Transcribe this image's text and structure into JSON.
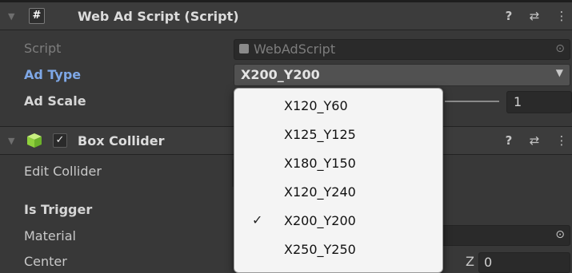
{
  "colors": {
    "panel_bg": "#383838",
    "header_bg": "#3c3c3c",
    "highlight_label": "#7ea7e6",
    "popup_bg": "#f4f4f4"
  },
  "web_ad_script": {
    "foldout_icon": "triangle-down-icon",
    "script_icon": "#",
    "title": "Web Ad Script (Script)",
    "help_icon": "?",
    "presets_icon": "⇄",
    "menu_icon": "⋮",
    "script_label": "Script",
    "script_value": "WebAdScript",
    "ad_type_label": "Ad Type",
    "ad_type_value": "X200_Y200",
    "ad_scale_label": "Ad Scale",
    "ad_scale_value": "1"
  },
  "box_collider": {
    "title": "Box Collider",
    "enabled_check": "✓",
    "help_icon": "?",
    "presets_icon": "⇄",
    "menu_icon": "⋮",
    "edit_collider_label": "Edit Collider",
    "is_trigger_label": "Is Trigger",
    "material_label": "Material",
    "center_label": "Center",
    "center_z_label": "Z",
    "center_z_value": "0"
  },
  "ad_type_dropdown": {
    "options": [
      "X120_Y60",
      "X125_Y125",
      "X180_Y150",
      "X120_Y240",
      "X200_Y200",
      "X250_Y250"
    ],
    "selected_index": 4,
    "check_glyph": "✓"
  }
}
